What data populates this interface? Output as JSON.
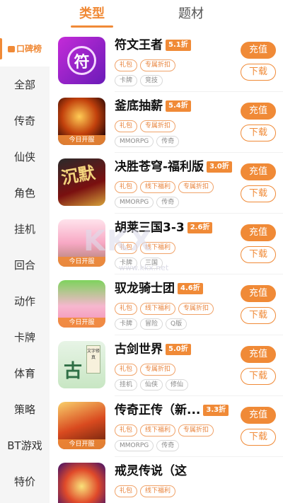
{
  "tabs": [
    {
      "label": "类型",
      "active": true
    },
    {
      "label": "题材",
      "active": false
    }
  ],
  "sidebar": {
    "items": [
      {
        "label": "口碑榜",
        "active": true
      },
      {
        "label": "全部"
      },
      {
        "label": "传奇"
      },
      {
        "label": "仙侠"
      },
      {
        "label": "角色"
      },
      {
        "label": "挂机"
      },
      {
        "label": "回合"
      },
      {
        "label": "动作"
      },
      {
        "label": "卡牌"
      },
      {
        "label": "体育"
      },
      {
        "label": "策略"
      },
      {
        "label": "BT游戏"
      },
      {
        "label": "特价"
      }
    ]
  },
  "games": [
    {
      "name": "符文王者",
      "discount": "5.1折",
      "badge": "",
      "tags": [
        "礼包",
        "专属折扣"
      ],
      "cats": [
        "卡牌",
        "竞技"
      ],
      "icon_glyph": "符"
    },
    {
      "name": "釜底抽薪",
      "discount": "5.4折",
      "badge": "今日开服",
      "tags": [
        "礼包",
        "专属折扣"
      ],
      "cats": [
        "MMORPG",
        "传奇"
      ],
      "icon_glyph": ""
    },
    {
      "name": "决胜苍穹-福利版",
      "discount": "3.0折",
      "badge": "",
      "tags": [
        "礼包",
        "线下福利",
        "专属折扣"
      ],
      "cats": [
        "MMORPG",
        "传奇"
      ],
      "icon_glyph": "沉默"
    },
    {
      "name": "胡莱三国3-3",
      "discount": "2.6折",
      "badge": "今日开服",
      "tags": [
        "礼包",
        "线下福利"
      ],
      "cats": [
        "卡牌",
        "三国"
      ],
      "icon_glyph": ""
    },
    {
      "name": "驭龙骑士团",
      "discount": "4.6折",
      "badge": "今日开服",
      "tags": [
        "礼包",
        "线下福利",
        "专属折扣"
      ],
      "cats": [
        "卡牌",
        "冒险",
        "Q版"
      ],
      "icon_glyph": ""
    },
    {
      "name": "古剑世界",
      "discount": "5.0折",
      "badge": "",
      "tags": [
        "礼包",
        "专属折扣"
      ],
      "cats": [
        "挂机",
        "仙侠",
        "修仙"
      ],
      "icon_glyph": "古"
    },
    {
      "name": "传奇正传（新...",
      "discount": "3.3折",
      "badge": "今日开服",
      "tags": [
        "礼包",
        "线下福利",
        "专属折扣"
      ],
      "cats": [
        "MMORPG",
        "传奇"
      ],
      "icon_glyph": ""
    },
    {
      "name": "戒灵传说（这",
      "discount": "",
      "badge": "",
      "tags": [
        "礼包",
        "线下福利"
      ],
      "cats": [],
      "icon_glyph": ""
    }
  ],
  "buttons": {
    "charge": "充值",
    "download": "下载"
  },
  "icon6_paper": "文字修真",
  "watermark": {
    "text": "KKX",
    "url": "www.kkx.net"
  },
  "colors": {
    "accent": "#f08a37",
    "sidebar_bg": "#f5f5f5"
  }
}
